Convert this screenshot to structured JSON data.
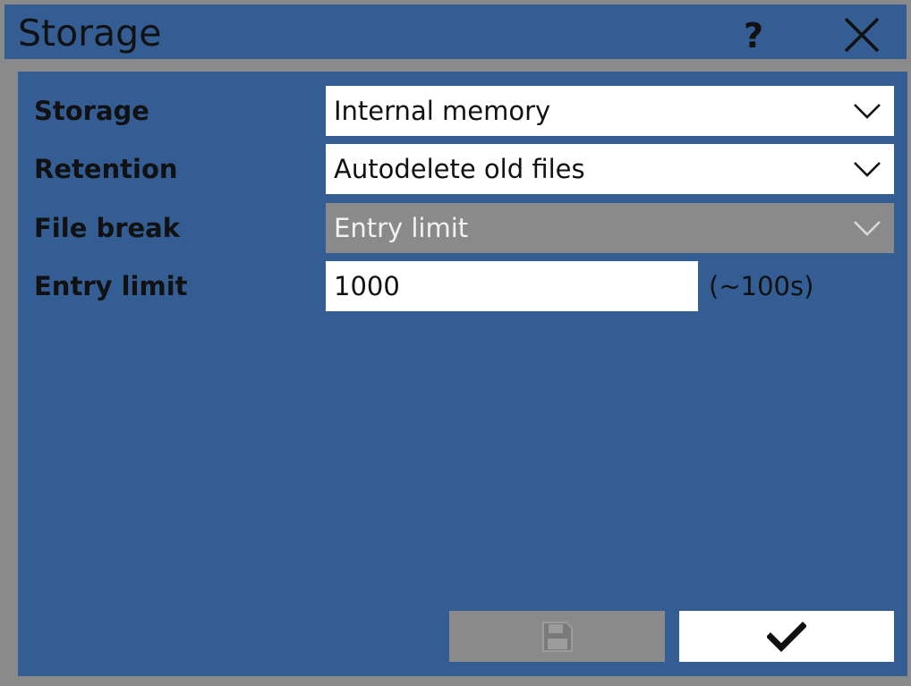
{
  "window": {
    "title": "Storage",
    "help_glyph": "?",
    "close_icon": "close-icon"
  },
  "form": {
    "storage": {
      "label": "Storage",
      "value": "Internal memory"
    },
    "retention": {
      "label": "Retention",
      "value": "Autodelete old files"
    },
    "file_break": {
      "label": "File break",
      "value": "Entry limit",
      "disabled": true
    },
    "entry_limit": {
      "label": "Entry limit",
      "value": "1000",
      "hint": "(~100s)"
    }
  },
  "actions": {
    "save_icon": "floppy-disk-icon",
    "save_disabled": true,
    "confirm_icon": "checkmark-icon"
  },
  "colors": {
    "background": "#345d94",
    "frame": "#8a8a8a",
    "field": "#ffffff",
    "disabled_field": "#8a8a8a",
    "text": "#111111"
  }
}
